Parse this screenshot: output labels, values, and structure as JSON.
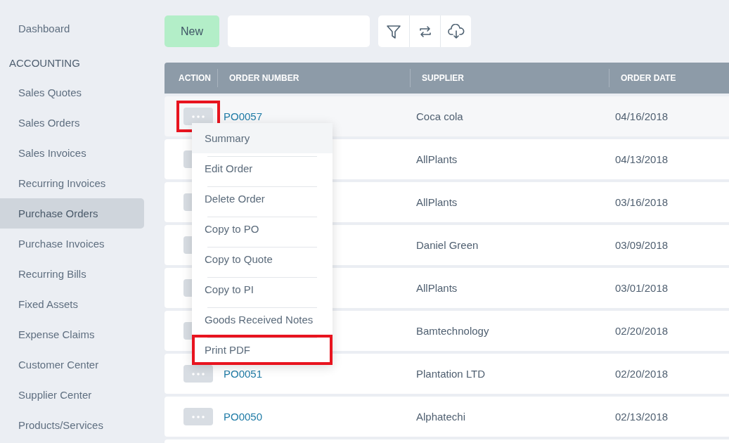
{
  "sidebar": {
    "items": [
      {
        "label": "Dashboard",
        "kind": "link",
        "selected": false
      },
      {
        "label": "ACCOUNTING",
        "kind": "heading"
      },
      {
        "label": "Sales Quotes",
        "kind": "link",
        "selected": false
      },
      {
        "label": "Sales Orders",
        "kind": "link",
        "selected": false
      },
      {
        "label": "Sales Invoices",
        "kind": "link",
        "selected": false
      },
      {
        "label": "Recurring Invoices",
        "kind": "link",
        "selected": false
      },
      {
        "label": "Purchase Orders",
        "kind": "link",
        "selected": true
      },
      {
        "label": "Purchase Invoices",
        "kind": "link",
        "selected": false
      },
      {
        "label": "Recurring Bills",
        "kind": "link",
        "selected": false
      },
      {
        "label": "Fixed Assets",
        "kind": "link",
        "selected": false
      },
      {
        "label": "Expense Claims",
        "kind": "link",
        "selected": false
      },
      {
        "label": "Customer Center",
        "kind": "link",
        "selected": false
      },
      {
        "label": "Supplier Center",
        "kind": "link",
        "selected": false
      },
      {
        "label": "Products/Services",
        "kind": "link",
        "selected": false
      }
    ]
  },
  "toolbar": {
    "new_button": "New"
  },
  "table": {
    "columns": [
      "ACTION",
      "ORDER NUMBER",
      "SUPPLIER",
      "ORDER DATE"
    ],
    "rows": [
      {
        "order_number": "PO0057",
        "supplier": "Coca cola",
        "order_date": "04/16/2018",
        "action_highlighted": true
      },
      {
        "supplier": "AllPlants",
        "order_date": "04/13/2018"
      },
      {
        "supplier": "AllPlants",
        "order_date": "03/16/2018"
      },
      {
        "supplier": "Daniel Green",
        "order_date": "03/09/2018"
      },
      {
        "supplier": "AllPlants",
        "order_date": "03/01/2018"
      },
      {
        "supplier": "Bamtechnology",
        "order_date": "02/20/2018"
      },
      {
        "order_number": "PO0051",
        "supplier": "Plantation LTD",
        "order_date": "02/20/2018"
      },
      {
        "order_number": "PO0050",
        "supplier": "Alphatechi",
        "order_date": "02/13/2018"
      },
      {}
    ]
  },
  "action_menu": {
    "items": [
      {
        "label": "Summary",
        "selected": true,
        "highlighted": false
      },
      {
        "label": "Edit Order",
        "selected": false,
        "highlighted": false
      },
      {
        "label": "Delete Order",
        "selected": false,
        "highlighted": false
      },
      {
        "label": "Copy to PO",
        "selected": false,
        "highlighted": false
      },
      {
        "label": "Copy to Quote",
        "selected": false,
        "highlighted": false
      },
      {
        "label": "Copy to PI",
        "selected": false,
        "highlighted": false
      },
      {
        "label": "Goods Received Notes",
        "selected": false,
        "highlighted": false
      },
      {
        "label": "Print PDF",
        "selected": false,
        "highlighted": true
      }
    ]
  }
}
